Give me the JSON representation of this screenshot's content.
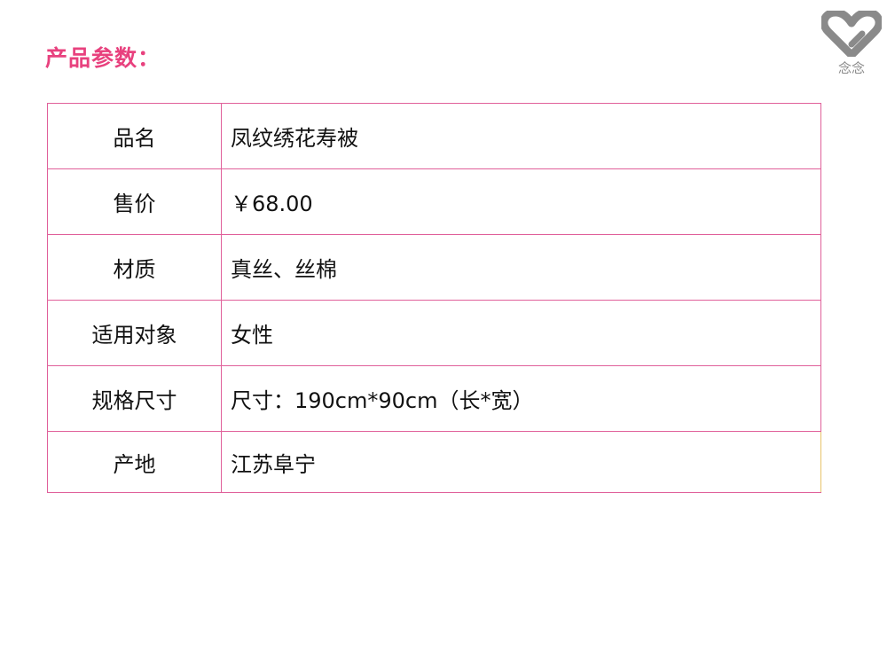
{
  "header": {
    "title": "产品参数："
  },
  "logo": {
    "icon": "heart-icon",
    "text": "念念",
    "color": "#8a8a8a"
  },
  "colors": {
    "accent": "#e8417e",
    "border": "#e0609a"
  },
  "spec_table": {
    "rows": [
      {
        "label": "品名",
        "value": "凤纹绣花寿被"
      },
      {
        "label": "售价",
        "value": "￥68.00"
      },
      {
        "label": "材质",
        "value": "真丝、丝棉"
      },
      {
        "label": "适用对象",
        "value": "女性"
      },
      {
        "label": "规格尺寸",
        "value": "尺寸：190cm*90cm（长*宽）"
      },
      {
        "label": "产地",
        "value": "江苏阜宁"
      }
    ]
  }
}
